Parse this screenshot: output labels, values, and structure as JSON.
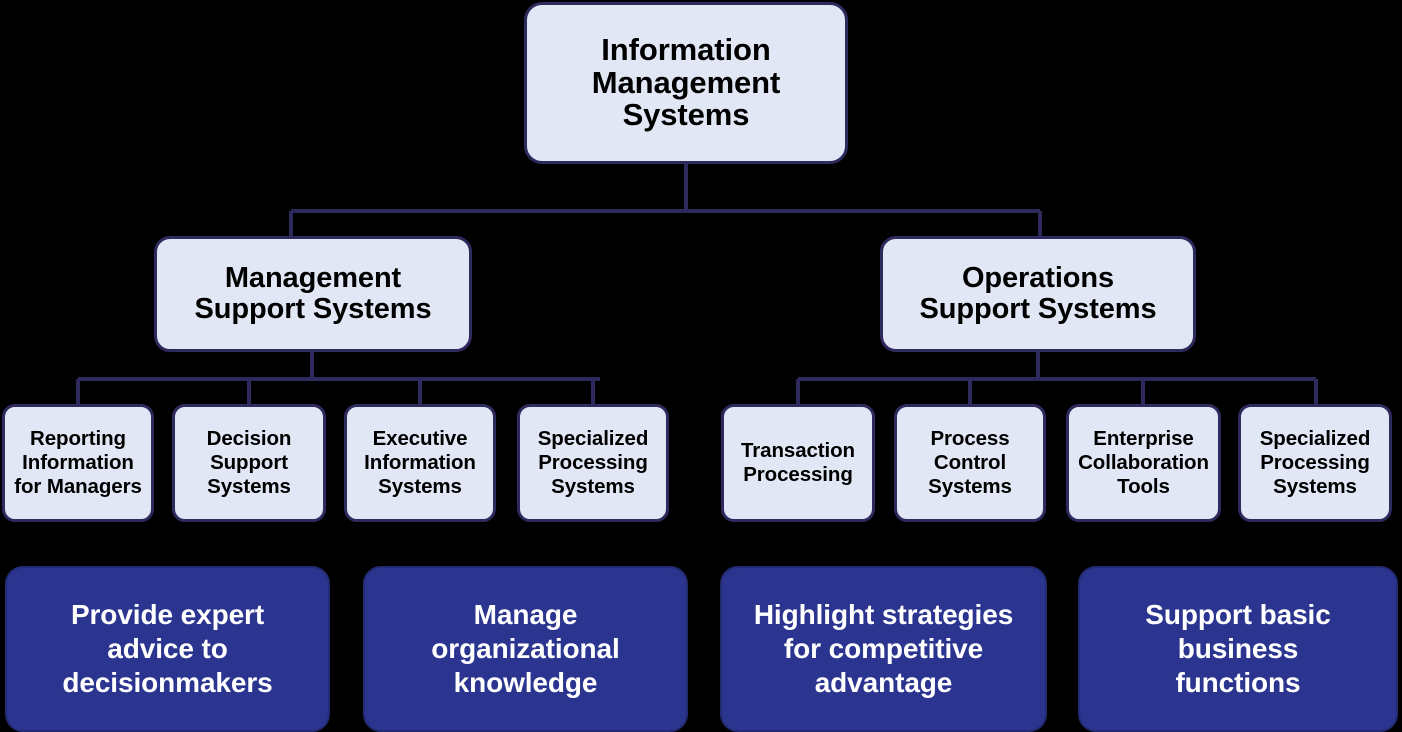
{
  "diagram": {
    "title": "Information Management Systems",
    "colors": {
      "background": "#000000",
      "node_fill": "#e2e7f5",
      "node_border": "#2e2a5e",
      "accent_fill": "#2b3590",
      "accent_text": "#ffffff",
      "connector": "#2e2a5e"
    },
    "root": {
      "label": "Information\nManagement\nSystems"
    },
    "level2": [
      {
        "label": "Management\nSupport Systems"
      },
      {
        "label": "Operations\nSupport Systems"
      }
    ],
    "level3": [
      {
        "label": "Reporting\nInformation\nfor Managers"
      },
      {
        "label": "Decision\nSupport\nSystems"
      },
      {
        "label": "Executive\nInformation\nSystems"
      },
      {
        "label": "Specialized\nProcessing\nSystems"
      },
      {
        "label": "Transaction\nProcessing"
      },
      {
        "label": "Process\nControl\nSystems"
      },
      {
        "label": "Enterprise\nCollaboration\nTools"
      },
      {
        "label": "Specialized\nProcessing\nSystems"
      }
    ],
    "level4": [
      {
        "label": "Provide expert\nadvice to\ndecisionmakers"
      },
      {
        "label": "Manage\norganizational\nknowledge"
      },
      {
        "label": "Highlight strategies\nfor competitive\nadvantage"
      },
      {
        "label": "Support basic\nbusiness\nfunctions"
      }
    ]
  }
}
